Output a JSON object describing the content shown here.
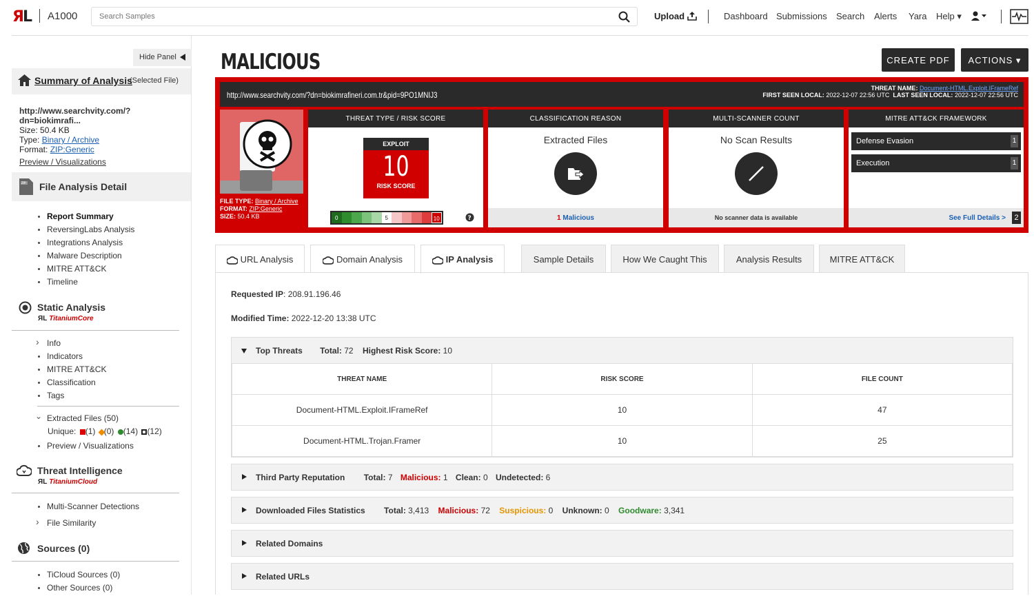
{
  "app": {
    "logo_r": "Я",
    "logo_l": "L",
    "name": "A1000"
  },
  "search": {
    "placeholder": "Search Samples"
  },
  "nav": {
    "upload": "Upload",
    "items": [
      "Dashboard",
      "Submissions",
      "Search",
      "Alerts",
      "Yara",
      "Help ▾"
    ]
  },
  "sidebar": {
    "hide_panel": "Hide Panel",
    "summary_title": "Summary of Analysis",
    "summary_sub": "(Selected File)",
    "file_name": "http://www.searchvity.com/?dn=biokimrafi...",
    "size_label": "Size:",
    "size": "50.4 KB",
    "type_label": "Type:",
    "type": "Binary / Archive",
    "format_label": "Format:",
    "format": "ZIP:Generic",
    "preview": "Preview / Visualizations",
    "fad_title": "File Analysis Detail",
    "fad_items": [
      "Report Summary",
      "ReversingLabs Analysis",
      "Integrations Analysis",
      "Malware Description",
      "MITRE ATT&CK",
      "Timeline"
    ],
    "static_title": "Static Analysis",
    "static_sub": "TitaniumCore",
    "static_items": [
      "Info",
      "Indicators",
      "MITRE ATT&CK",
      "Classification",
      "Tags"
    ],
    "extracted": "Extracted Files (50)",
    "unique_label": "Unique:",
    "unique_counts": [
      "(1)",
      "(0)",
      "(14)",
      "(12)"
    ],
    "preview2": "Preview / Visualizations",
    "ti_title": "Threat Intelligence",
    "ti_sub": "TitaniumCloud",
    "ti_items": [
      "Multi-Scanner Detections",
      "File Similarity"
    ],
    "sources_title": "Sources (0)",
    "sources_items": [
      "TiCloud Sources (0)",
      "Other Sources (0)"
    ]
  },
  "main": {
    "verdict": "MALICIOUS",
    "create_pdf": "CREATE PDF",
    "actions": "ACTIONS ▾",
    "url": "http://www.searchvity.com/?dn=biokimrafineri.com.tr&pid=9PO1MNIJ3",
    "threat_name_label": "THREAT NAME:",
    "threat_name": "Document-HTML.Exploit.IFrameRef",
    "first_seen_label": "FIRST SEEN LOCAL:",
    "first_seen": "2022-12-07 22:56 UTC",
    "last_seen_label": "LAST SEEN LOCAL:",
    "last_seen": "2022-12-07 22:56 UTC",
    "filetype_label": "FILE TYPE:",
    "filetype": "Binary / Archive",
    "format_label": "FORMAT:",
    "format": "ZIP:Generic",
    "size_label": "SIZE:",
    "size": "50.4 KB",
    "panels": {
      "threat_header": "THREAT TYPE / RISK SCORE",
      "threat_type": "EXPLOIT",
      "risk_score": "10",
      "risk_label": "RISK SCORE",
      "scale_labels": [
        "0",
        "5",
        "10"
      ],
      "class_header": "CLASSIFICATION REASON",
      "class_reason": "Extracted Files",
      "class_count": "1",
      "class_link": "Malicious",
      "ms_header": "MULTI-SCANNER COUNT",
      "ms_value": "No Scan Results",
      "ms_footer": "No scanner data is available",
      "mitre_header": "MITRE ATT&CK FRAMEWORK",
      "mitre_rows": [
        {
          "name": "Defense Evasion",
          "count": "1"
        },
        {
          "name": "Execution",
          "count": "1"
        }
      ],
      "mitre_link": "See Full Details >",
      "mitre_total": "2"
    },
    "tabs": [
      "URL Analysis",
      "Domain Analysis",
      "IP Analysis",
      "Sample Details",
      "How We Caught This",
      "Analysis Results",
      "MITRE ATT&CK"
    ],
    "requested_ip_label": "Requested IP",
    "requested_ip": ": 208.91.196.46",
    "modified_label": "Modified Time:",
    "modified": "2022-12-20 13:38 UTC",
    "top_threats": {
      "title": "Top Threats",
      "total_label": "Total:",
      "total": "72",
      "highest_label": "Highest Risk Score:",
      "highest": "10",
      "columns": [
        "THREAT NAME",
        "RISK SCORE",
        "FILE COUNT"
      ],
      "rows": [
        [
          "Document-HTML.Exploit.IFrameRef",
          "10",
          "47"
        ],
        [
          "Document-HTML.Trojan.Framer",
          "10",
          "25"
        ]
      ]
    },
    "third_party": {
      "title": "Third Party Reputation",
      "total_label": "Total:",
      "total": "7",
      "malicious_label": "Malicious:",
      "malicious": "1",
      "clean_label": "Clean:",
      "clean": "0",
      "undetected_label": "Undetected:",
      "undetected": "6"
    },
    "downloaded": {
      "title": "Downloaded Files Statistics",
      "total_label": "Total:",
      "total": "3,413",
      "malicious_label": "Malicious:",
      "malicious": "72",
      "suspicious_label": "Suspicious:",
      "suspicious": "0",
      "unknown_label": "Unknown:",
      "unknown": "0",
      "goodware_label": "Goodware:",
      "goodware": "3,341"
    },
    "related_domains": "Related Domains",
    "related_urls": "Related URLs"
  }
}
